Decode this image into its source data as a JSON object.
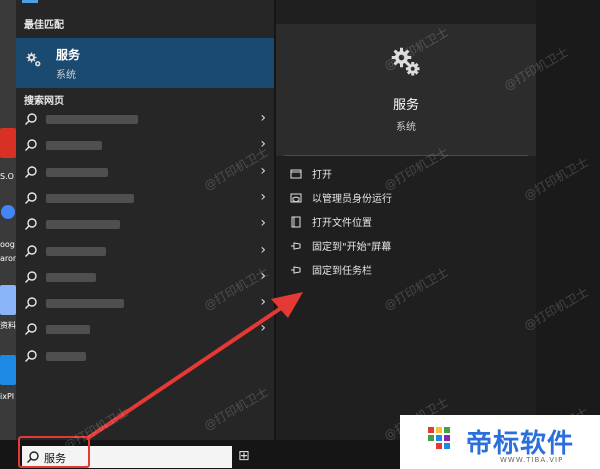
{
  "desktop": {
    "labels": [
      "S.O",
      "oog",
      "aron",
      "资料",
      "ixPI"
    ],
    "colors": [
      "#d93025",
      "#34a853",
      "#4285f4",
      "#8ab4f8",
      "#1e88e5"
    ]
  },
  "best_match": {
    "section_label": "最佳匹配",
    "title": "服务",
    "subtitle": "系统",
    "icon": "gear-icon"
  },
  "web_search": {
    "section_label": "搜索网页",
    "rows": [
      {
        "blur": 92
      },
      {
        "blur": 56
      },
      {
        "blur": 62
      },
      {
        "blur": 88
      },
      {
        "blur": 74
      },
      {
        "blur": 60
      },
      {
        "blur": 50
      },
      {
        "blur": 78
      },
      {
        "blur": 44
      },
      {
        "blur": 40
      }
    ],
    "chevron": "›"
  },
  "preview": {
    "title": "服务",
    "subtitle": "系统",
    "actions": [
      {
        "label": "打开",
        "icon": "open-icon"
      },
      {
        "label": "以管理员身份运行",
        "icon": "shield-icon"
      },
      {
        "label": "打开文件位置",
        "icon": "folder-icon"
      },
      {
        "label": "固定到\"开始\"屏幕",
        "icon": "pin-icon"
      },
      {
        "label": "固定到任务栏",
        "icon": "pin-icon"
      }
    ]
  },
  "taskbar": {
    "search_value": "服务"
  },
  "watermark": "@打印机卫士",
  "logo": {
    "text": "帝标软件",
    "sub": "WWW.TIBA.VIP"
  },
  "colors": {
    "accent": "#4f9fe3",
    "selected": "#1b4a70",
    "highlight": "#e53935"
  }
}
